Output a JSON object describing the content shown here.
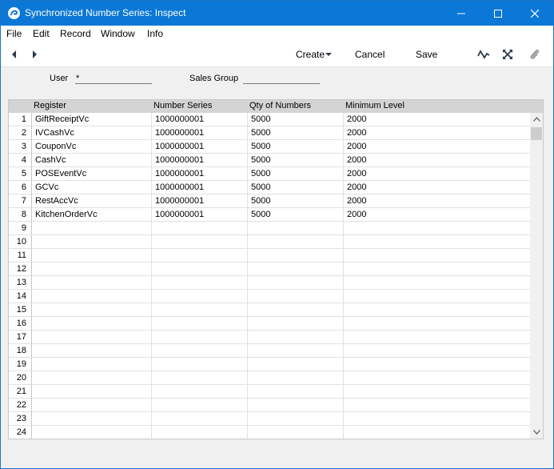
{
  "window": {
    "title": "Synchronized Number Series: Inspect",
    "colors": {
      "titlebar": "#0b78d7",
      "background": "#f0f0f0"
    }
  },
  "menu": {
    "items": [
      "File",
      "Edit",
      "Record",
      "Window",
      "Info"
    ]
  },
  "toolbar": {
    "create_label": "Create",
    "cancel_label": "Cancel",
    "save_label": "Save"
  },
  "header": {
    "user_label": "User",
    "user_value": "*",
    "sales_group_label": "Sales Group",
    "sales_group_value": ""
  },
  "grid": {
    "columns": [
      "Register",
      "Number Series",
      "Qty of Numbers",
      "Minimum Level"
    ],
    "rows": [
      {
        "n": "1",
        "register": "GiftReceiptVc",
        "number_series": "1000000001",
        "qty": "5000",
        "min": "2000"
      },
      {
        "n": "2",
        "register": "IVCashVc",
        "number_series": "1000000001",
        "qty": "5000",
        "min": "2000"
      },
      {
        "n": "3",
        "register": "CouponVc",
        "number_series": "1000000001",
        "qty": "5000",
        "min": "2000"
      },
      {
        "n": "4",
        "register": "CashVc",
        "number_series": "1000000001",
        "qty": "5000",
        "min": "2000"
      },
      {
        "n": "5",
        "register": "POSEventVc",
        "number_series": "1000000001",
        "qty": "5000",
        "min": "2000"
      },
      {
        "n": "6",
        "register": "GCVc",
        "number_series": "1000000001",
        "qty": "5000",
        "min": "2000"
      },
      {
        "n": "7",
        "register": "RestAccVc",
        "number_series": "1000000001",
        "qty": "5000",
        "min": "2000"
      },
      {
        "n": "8",
        "register": "KitchenOrderVc",
        "number_series": "1000000001",
        "qty": "5000",
        "min": "2000"
      },
      {
        "n": "9",
        "register": "",
        "number_series": "",
        "qty": "",
        "min": ""
      },
      {
        "n": "10",
        "register": "",
        "number_series": "",
        "qty": "",
        "min": ""
      },
      {
        "n": "11",
        "register": "",
        "number_series": "",
        "qty": "",
        "min": ""
      },
      {
        "n": "12",
        "register": "",
        "number_series": "",
        "qty": "",
        "min": ""
      },
      {
        "n": "13",
        "register": "",
        "number_series": "",
        "qty": "",
        "min": ""
      },
      {
        "n": "14",
        "register": "",
        "number_series": "",
        "qty": "",
        "min": ""
      },
      {
        "n": "15",
        "register": "",
        "number_series": "",
        "qty": "",
        "min": ""
      },
      {
        "n": "16",
        "register": "",
        "number_series": "",
        "qty": "",
        "min": ""
      },
      {
        "n": "17",
        "register": "",
        "number_series": "",
        "qty": "",
        "min": ""
      },
      {
        "n": "18",
        "register": "",
        "number_series": "",
        "qty": "",
        "min": ""
      },
      {
        "n": "19",
        "register": "",
        "number_series": "",
        "qty": "",
        "min": ""
      },
      {
        "n": "20",
        "register": "",
        "number_series": "",
        "qty": "",
        "min": ""
      },
      {
        "n": "21",
        "register": "",
        "number_series": "",
        "qty": "",
        "min": ""
      },
      {
        "n": "22",
        "register": "",
        "number_series": "",
        "qty": "",
        "min": ""
      },
      {
        "n": "23",
        "register": "",
        "number_series": "",
        "qty": "",
        "min": ""
      },
      {
        "n": "24",
        "register": "",
        "number_series": "",
        "qty": "",
        "min": ""
      }
    ]
  }
}
